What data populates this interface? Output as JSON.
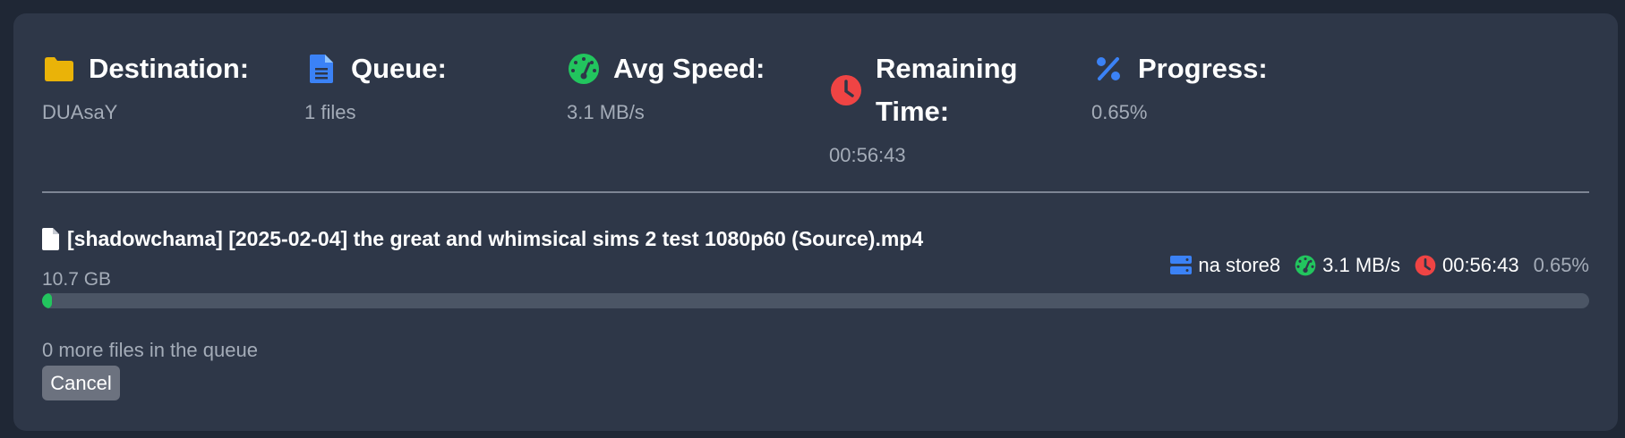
{
  "stats": [
    {
      "icon": "folder-icon",
      "label": "Destination:",
      "value": "DUAsaY"
    },
    {
      "icon": "file-text-icon",
      "label": "Queue:",
      "value": "1 files"
    },
    {
      "icon": "speedometer-icon",
      "label": "Avg Speed:",
      "value": "3.1 MB/s"
    },
    {
      "icon": "clock-icon",
      "label": "Remaining Time:",
      "value": "00:56:43"
    },
    {
      "icon": "percent-icon",
      "label": "Progress:",
      "value": "0.65%"
    }
  ],
  "current_file": {
    "name": "[shadowchama] [2025-02-04] the great and whimsical sims 2 test 1080p60 (Source).mp4",
    "size": "10.7 GB",
    "server": "na store8",
    "speed": "3.1 MB/s",
    "remaining": "00:56:43",
    "progress_label": "0.65%",
    "progress_fraction": 0.0065
  },
  "queue_note": "0 more files in the queue",
  "cancel_label": "Cancel",
  "colors": {
    "background": "#1f2735",
    "panel": "#2e3748",
    "folder": "#eab308",
    "file": "#3b82f6",
    "speed": "#22c55e",
    "clock": "#ef4444",
    "percent": "#3b82f6",
    "progress": "#22c55e"
  }
}
